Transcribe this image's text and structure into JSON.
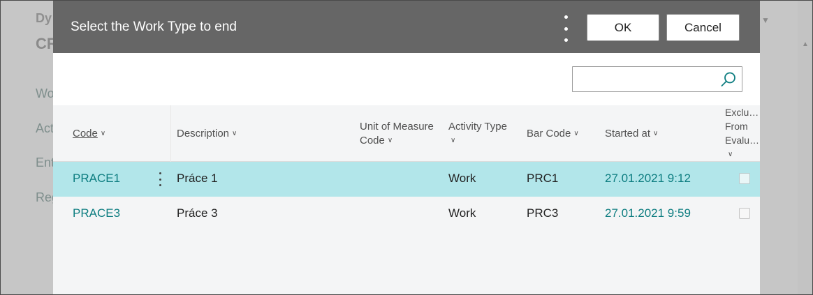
{
  "background": {
    "brand": "Dy",
    "title": "CR",
    "nav": [
      "Wo",
      "Act",
      "Ent",
      "Reg"
    ]
  },
  "dialog": {
    "title": "Select the Work Type to end",
    "ok_label": "OK",
    "cancel_label": "Cancel",
    "search": {
      "value": "",
      "placeholder": ""
    }
  },
  "grid": {
    "columns": {
      "code": "Code",
      "description": "Description",
      "uom_line1": "Unit of Measure",
      "uom_line2": "Code",
      "activity": "Activity Type",
      "bar_code": "Bar Code",
      "started_at": "Started at",
      "excl_line1": "Exclu…",
      "excl_line2": "From",
      "excl_line3": "Evalu…"
    },
    "rows": [
      {
        "code": "PRACE1",
        "description": "Práce 1",
        "uom": "",
        "activity": "Work",
        "bar_code": "PRC1",
        "started_at": "27.01.2021 9:12",
        "excluded": false,
        "selected": true
      },
      {
        "code": "PRACE3",
        "description": "Práce 3",
        "uom": "",
        "activity": "Work",
        "bar_code": "PRC3",
        "started_at": "27.01.2021 9:59",
        "excluded": false,
        "selected": false
      }
    ]
  },
  "colors": {
    "header_bg": "#666666",
    "selected_row": "#b2e6ea",
    "link": "#0d7d80"
  }
}
